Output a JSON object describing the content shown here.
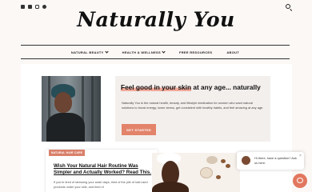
{
  "header": {
    "logo": "Naturally You",
    "social_icons": [
      "facebook-icon",
      "twitter-icon",
      "instagram-icon",
      "pinterest-icon"
    ],
    "search_icon": "search-icon"
  },
  "nav": {
    "items": [
      {
        "label": "NATURAL BEAUTY",
        "dropdown": true
      },
      {
        "label": "HEALTH & WELLNESS",
        "dropdown": true
      },
      {
        "label": "FREE RESOURCES",
        "dropdown": false
      },
      {
        "label": "ABOUT",
        "dropdown": false
      }
    ]
  },
  "intro": {
    "title_highlight": "Feel good in your skin",
    "title_rest": " at any age... naturally",
    "text": "Naturally You is the natural health, beauty, and lifestyle destination for women who want natural solutions to boost energy, lower stress, get consistent with healthy habits, and feel amazing at any age.",
    "cta_label": "GET STARTED"
  },
  "featured_post": {
    "category": "NATURAL HAIR CARE",
    "title": "Wish Your Natural Hair Routine Was Simpler and Actually Worked? Read This.",
    "excerpt": "If you're tired of stressing your wash days, tired of the pile of half-used products under your sink, and tired of"
  },
  "chat": {
    "message": "Hi there, have a question? Ask us here.",
    "close_icon": "close-icon",
    "launcher_icon": "chat-icon"
  },
  "colors": {
    "accent": "#e2836a",
    "highlight": "#f0a898",
    "background": "#fbf8f6"
  }
}
